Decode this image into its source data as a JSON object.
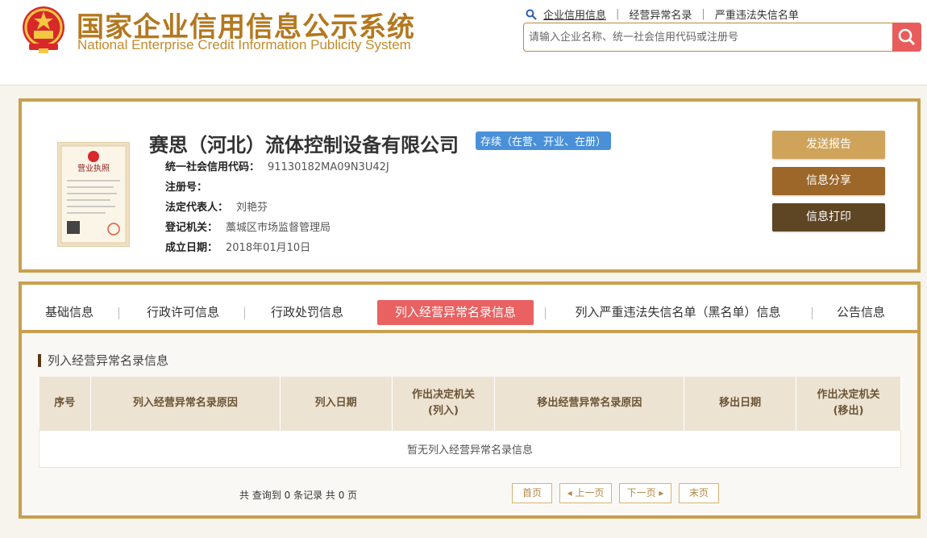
{
  "header": {
    "title_cn": "国家企业信用信息公示系统",
    "title_en": "National Enterprise Credit Information Publicity System",
    "nav": [
      "企业信用信息",
      "经营异常名录",
      "严重违法失信名单"
    ],
    "search_placeholder": "请输入企业名称、统一社会信用代码或注册号"
  },
  "company": {
    "name": "赛思（河北）流体控制设备有限公司",
    "status": "存续（在营、开业、在册）",
    "fields": [
      {
        "label": "统一社会信用代码：",
        "value": "91130182MA09N3U42J"
      },
      {
        "label": "注册号：",
        "value": ""
      },
      {
        "label": "法定代表人：",
        "value": "刘艳芬"
      },
      {
        "label": "登记机关：",
        "value": "藁城区市场监督管理局"
      },
      {
        "label": "成立日期：",
        "value": "2018年01月10日"
      }
    ],
    "license_label": "营业执照"
  },
  "actions": [
    "发送报告",
    "信息分享",
    "信息打印"
  ],
  "tabs": [
    "基础信息",
    "行政许可信息",
    "行政处罚信息",
    "列入经营异常名录信息",
    "列入严重违法失信名单（黑名单）信息",
    "公告信息"
  ],
  "section": {
    "title": "列入经营异常名录信息",
    "columns": [
      "序号",
      "列入经营异常名录原因",
      "列入日期",
      "作出决定机关(列入)",
      "移出经营异常名录原因",
      "移出日期",
      "作出决定机关(移出)"
    ],
    "empty_text": "暂无列入经营异常名录信息"
  },
  "pager": {
    "summary": "共 查询到 0 条记录 共 0 页",
    "first": "首页",
    "prev": "◂ 上一页",
    "next": "下一页 ▸",
    "last": "末页"
  },
  "colors": {
    "gold": "#c9a04f",
    "active_tab": "#e96161",
    "status_badge": "#4a90d9",
    "title": "#b4781f"
  }
}
